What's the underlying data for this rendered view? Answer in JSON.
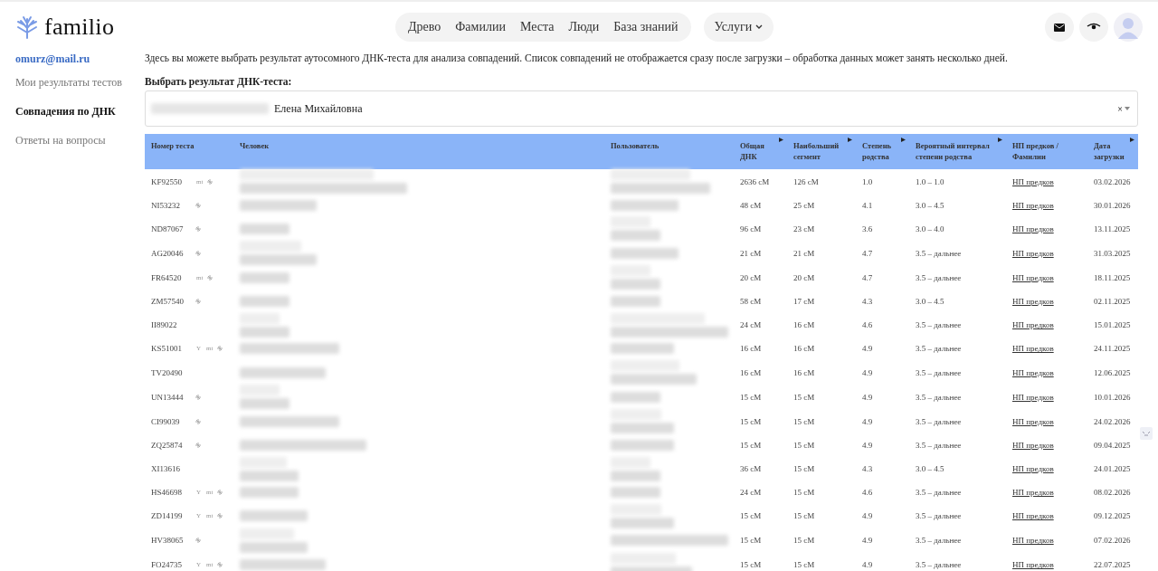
{
  "logo": {
    "text": "familio"
  },
  "nav": [
    {
      "label": "Древо"
    },
    {
      "label": "Фамилии"
    },
    {
      "label": "Места"
    },
    {
      "label": "Люди"
    },
    {
      "label": "База знаний"
    }
  ],
  "services": {
    "label": "Услуги"
  },
  "sidebar": {
    "email": "omurz@mail.ru",
    "items": [
      {
        "label": "Мои результаты тестов",
        "selected": false
      },
      {
        "label": "Совпадения по ДНК",
        "selected": true
      },
      {
        "label": "Ответы на вопросы",
        "selected": false
      }
    ]
  },
  "intro": "Здесь вы можете выбрать результат аутосомного ДНК-теста для анализа совпадений. Список совпадений не отображается сразу после загрузки – обработка данных может занять несколько дней.",
  "select": {
    "label": "Выбрать результат ДНК-теста:",
    "value": "Елена Михайловна",
    "clear": "×"
  },
  "table": {
    "columns": [
      {
        "label": "Номер теста",
        "sortable": false
      },
      {
        "label": "Человек",
        "sortable": false
      },
      {
        "label": "Пользователь",
        "sortable": false
      },
      {
        "label": "Общая ДНК",
        "sortable": true
      },
      {
        "label": "Наибольший сегмент",
        "sortable": true
      },
      {
        "label": "Степень родства",
        "sortable": true
      },
      {
        "label": "Вероятный интервал степени родства",
        "sortable": true
      },
      {
        "label": "НП предков / Фамилии",
        "sortable": false
      },
      {
        "label": "Дата загрузки",
        "sortable": true
      }
    ],
    "rows": [
      {
        "test": "KF92550",
        "tags": [
          "mt"
        ],
        "pin": true,
        "total": "2636 cM",
        "segment": "126 cM",
        "degree": "1.0",
        "interval": "1.0 – 1.0",
        "link": "НП предков",
        "date": "03.02.2026"
      },
      {
        "test": "NI53232",
        "tags": [],
        "pin": true,
        "total": "48 cM",
        "segment": "25 cM",
        "degree": "4.1",
        "interval": "3.0 – 4.5",
        "link": "НП предков",
        "date": "30.01.2026"
      },
      {
        "test": "ND87067",
        "tags": [],
        "pin": true,
        "total": "96 cM",
        "segment": "23 cM",
        "degree": "3.6",
        "interval": "3.0 – 4.0",
        "link": "НП предков",
        "date": "13.11.2025"
      },
      {
        "test": "AG20046",
        "tags": [],
        "pin": true,
        "total": "21 cM",
        "segment": "21 cM",
        "degree": "4.7",
        "interval": "3.5 – дальнее",
        "link": "НП предков",
        "date": "31.03.2025"
      },
      {
        "test": "FR64520",
        "tags": [
          "mt"
        ],
        "pin": true,
        "total": "20 cM",
        "segment": "20 cM",
        "degree": "4.7",
        "interval": "3.5 – дальнее",
        "link": "НП предков",
        "date": "18.11.2025"
      },
      {
        "test": "ZM57540",
        "tags": [],
        "pin": true,
        "total": "58 cM",
        "segment": "17 cM",
        "degree": "4.3",
        "interval": "3.0 – 4.5",
        "link": "НП предков",
        "date": "02.11.2025"
      },
      {
        "test": "II89022",
        "tags": [],
        "pin": false,
        "total": "24 cM",
        "segment": "16 cM",
        "degree": "4.6",
        "interval": "3.5 – дальнее",
        "link": "НП предков",
        "date": "15.01.2025"
      },
      {
        "test": "KS51001",
        "tags": [
          "Y",
          "mt"
        ],
        "pin": true,
        "total": "16 cM",
        "segment": "16 cM",
        "degree": "4.9",
        "interval": "3.5 – дальнее",
        "link": "НП предков",
        "date": "24.11.2025"
      },
      {
        "test": "TV20490",
        "tags": [],
        "pin": false,
        "total": "16 cM",
        "segment": "16 cM",
        "degree": "4.9",
        "interval": "3.5 – дальнее",
        "link": "НП предков",
        "date": "12.06.2025"
      },
      {
        "test": "UN13444",
        "tags": [],
        "pin": true,
        "total": "15 cM",
        "segment": "15 cM",
        "degree": "4.9",
        "interval": "3.5 – дальнее",
        "link": "НП предков",
        "date": "10.01.2026"
      },
      {
        "test": "CI99039",
        "tags": [],
        "pin": true,
        "total": "15 cM",
        "segment": "15 cM",
        "degree": "4.9",
        "interval": "3.5 – дальнее",
        "link": "НП предков",
        "date": "24.02.2026"
      },
      {
        "test": "ZQ25874",
        "tags": [],
        "pin": true,
        "total": "15 cM",
        "segment": "15 cM",
        "degree": "4.9",
        "interval": "3.5 – дальнее",
        "link": "НП предков",
        "date": "09.04.2025"
      },
      {
        "test": "XI13616",
        "tags": [],
        "pin": false,
        "total": "36 cM",
        "segment": "15 cM",
        "degree": "4.3",
        "interval": "3.0 – 4.5",
        "link": "НП предков",
        "date": "24.01.2025"
      },
      {
        "test": "HS46698",
        "tags": [
          "Y",
          "mt"
        ],
        "pin": true,
        "total": "24 cM",
        "segment": "15 cM",
        "degree": "4.6",
        "interval": "3.5 – дальнее",
        "link": "НП предков",
        "date": "08.02.2026"
      },
      {
        "test": "ZD14199",
        "tags": [
          "Y",
          "mt"
        ],
        "pin": true,
        "total": "15 cM",
        "segment": "15 cM",
        "degree": "4.9",
        "interval": "3.5 – дальнее",
        "link": "НП предков",
        "date": "09.12.2025"
      },
      {
        "test": "HV38065",
        "tags": [],
        "pin": true,
        "total": "15 cM",
        "segment": "15 cM",
        "degree": "4.9",
        "interval": "3.5 – дальнее",
        "link": "НП предков",
        "date": "07.02.2026"
      },
      {
        "test": "FO24735",
        "tags": [
          "Y",
          "mt"
        ],
        "pin": true,
        "total": "15 cM",
        "segment": "15 cM",
        "degree": "4.9",
        "interval": "3.5 – дальнее",
        "link": "НП предков",
        "date": "22.07.2025"
      }
    ]
  }
}
